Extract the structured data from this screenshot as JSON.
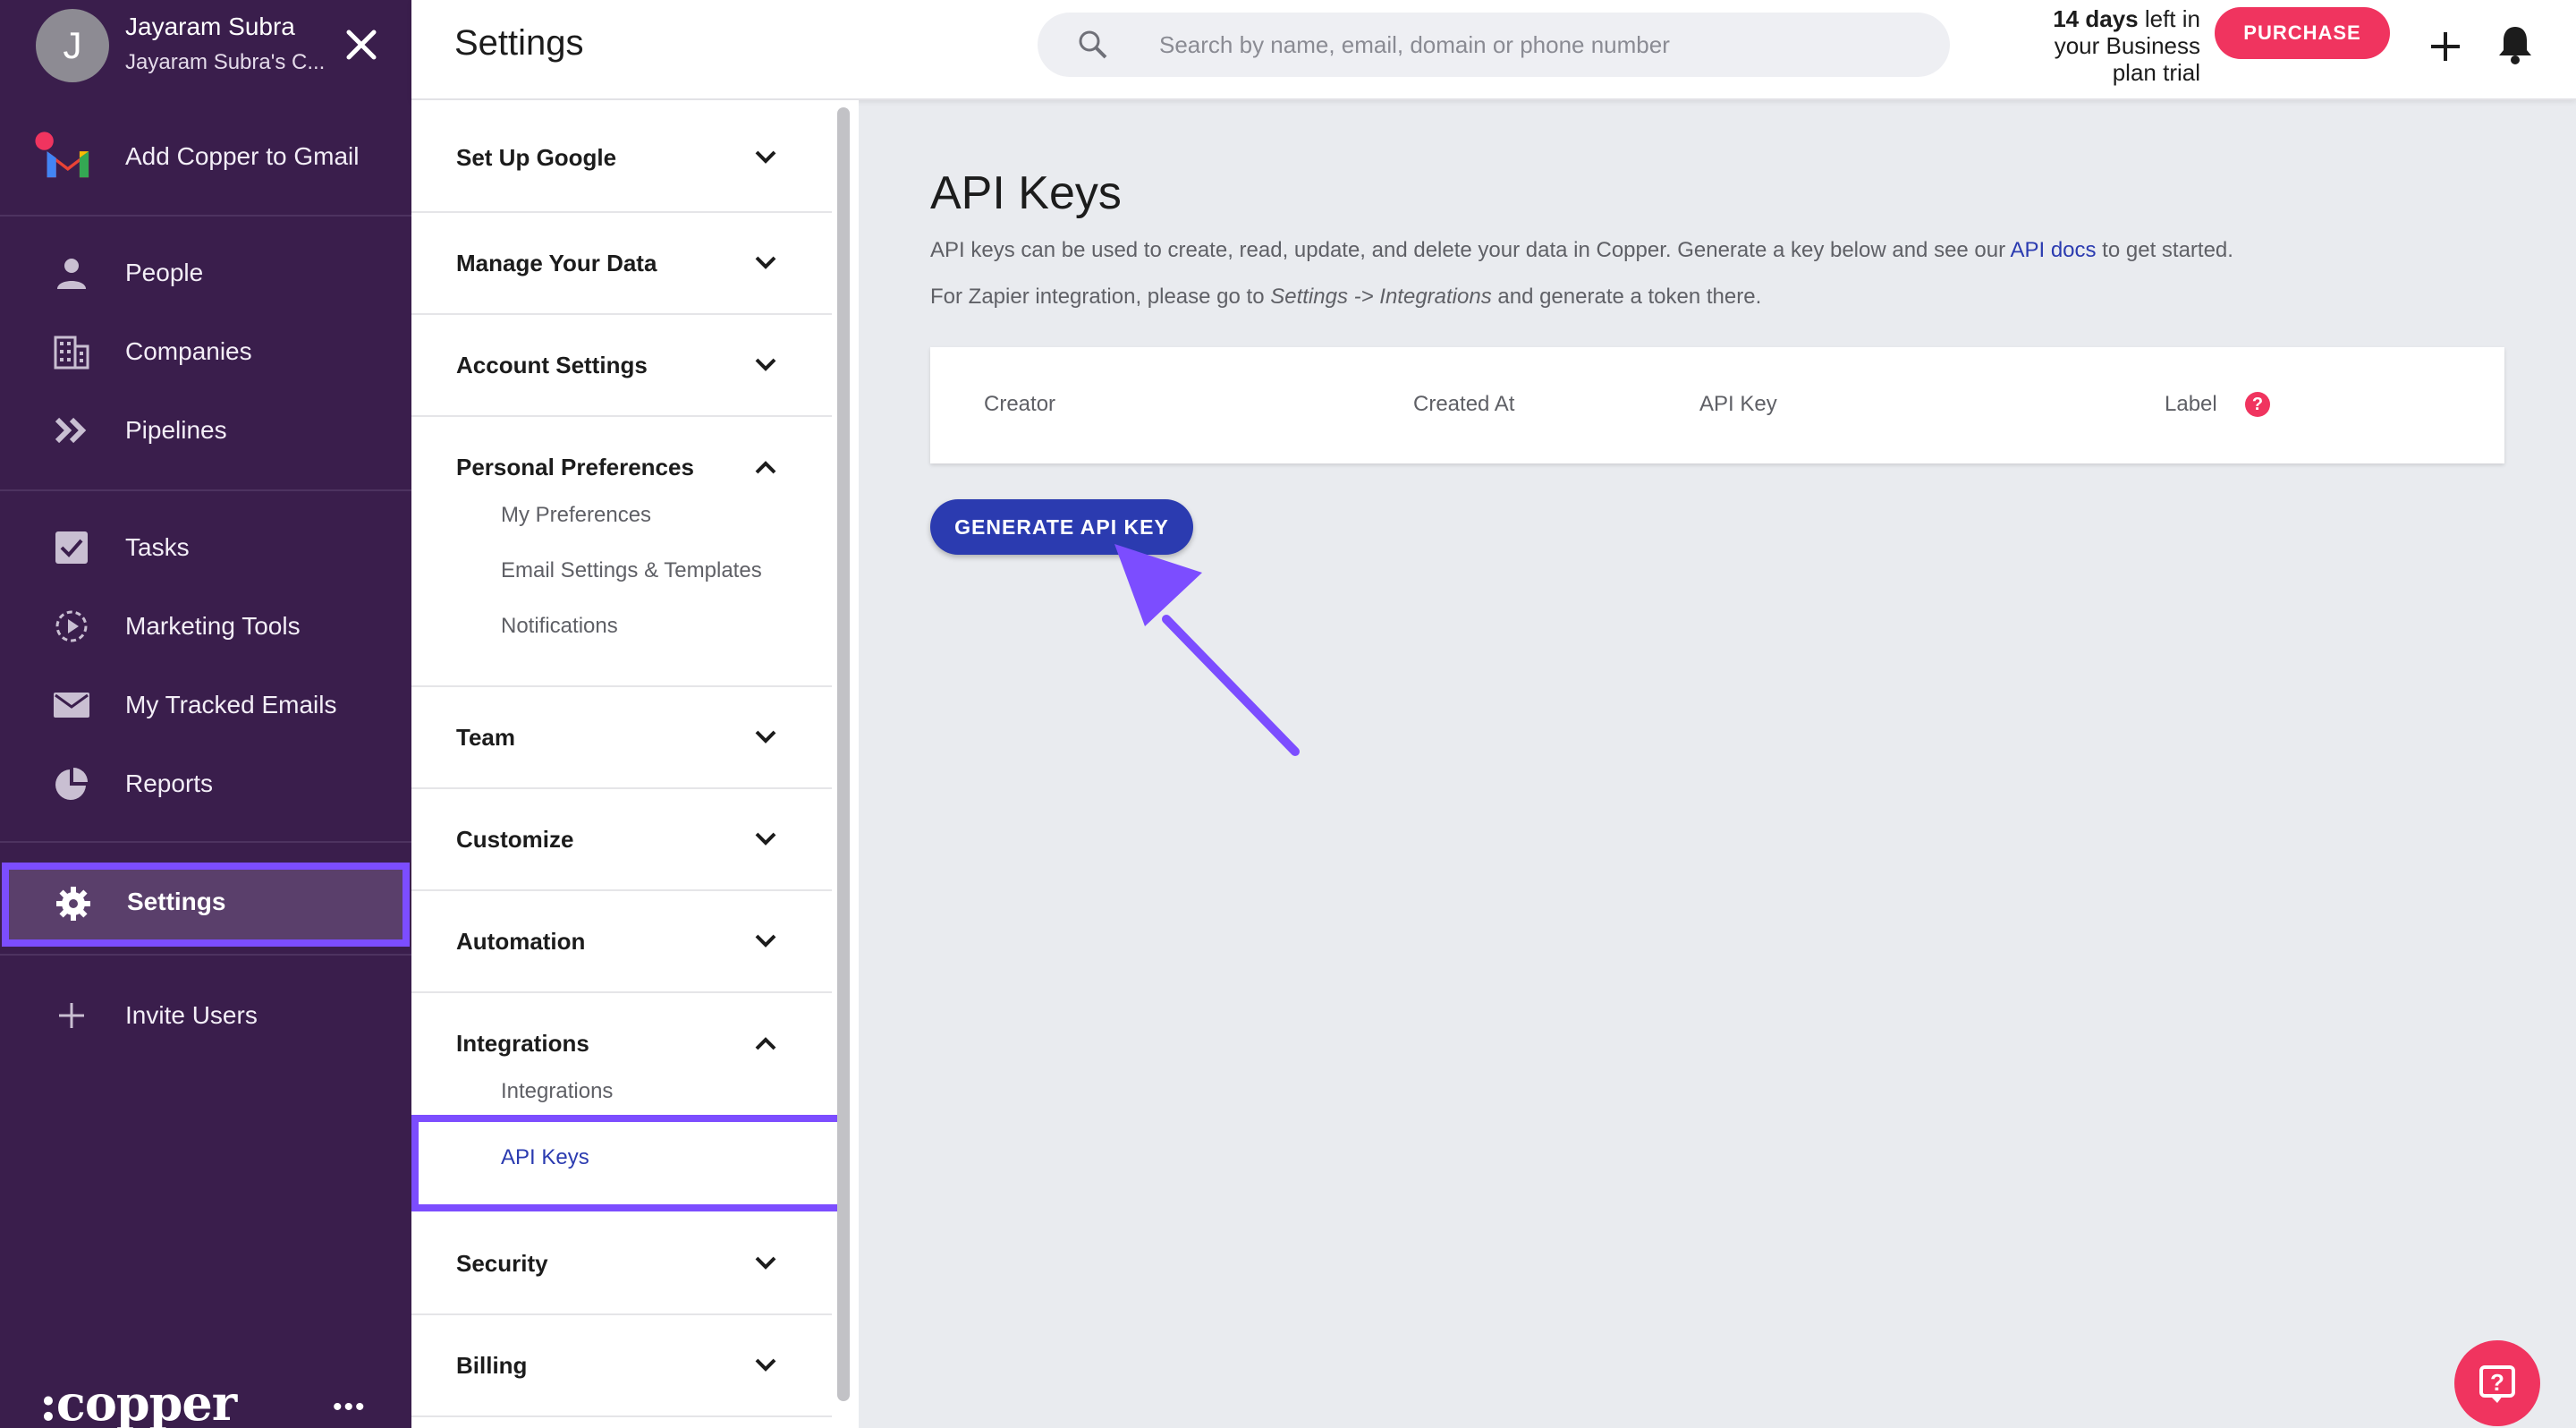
{
  "user": {
    "initial": "J",
    "name": "Jayaram Subra",
    "org": "Jayaram Subra's C..."
  },
  "nav": {
    "gmail": "Add Copper to Gmail",
    "people": "People",
    "companies": "Companies",
    "pipelines": "Pipelines",
    "tasks": "Tasks",
    "marketing": "Marketing Tools",
    "tracked": "My Tracked Emails",
    "reports": "Reports",
    "settings": "Settings",
    "invite": "Invite Users",
    "logo": ":copper",
    "more": "•••"
  },
  "header": {
    "title": "Settings",
    "search_placeholder": "Search by name, email, domain or phone number",
    "trial_bold": "14 days",
    "trial_rest1": " left in",
    "trial_line2": "your Business",
    "trial_line3": "plan trial",
    "purchase": "PURCHASE"
  },
  "menu": {
    "setup_google": "Set Up Google",
    "manage_data": "Manage Your Data",
    "account_settings": "Account Settings",
    "personal_prefs": "Personal Preferences",
    "my_prefs": "My Preferences",
    "email_settings": "Email Settings & Templates",
    "notifications": "Notifications",
    "team": "Team",
    "customize": "Customize",
    "automation": "Automation",
    "integrations": "Integrations",
    "integrations_sub": "Integrations",
    "api_keys": "API Keys",
    "security": "Security",
    "billing": "Billing"
  },
  "main": {
    "title": "API Keys",
    "desc1_a": "API keys can be used to create, read, update, and delete your data in Copper. Generate a key below and see our ",
    "desc1_link": "API docs",
    "desc1_b": " to get started.",
    "desc2_a": "For Zapier integration, please go to ",
    "desc2_italic1": "Settings -> Integrations",
    "desc2_b": " and generate a token there.",
    "col_creator": "Creator",
    "col_created": "Created At",
    "col_key": "API Key",
    "col_label": "Label",
    "help": "?",
    "generate": "GENERATE API KEY"
  },
  "colors": {
    "nav_bg": "#3a1e4c",
    "accent": "#7c4dff",
    "primary": "#2b3bb0",
    "danger": "#f0345f"
  }
}
